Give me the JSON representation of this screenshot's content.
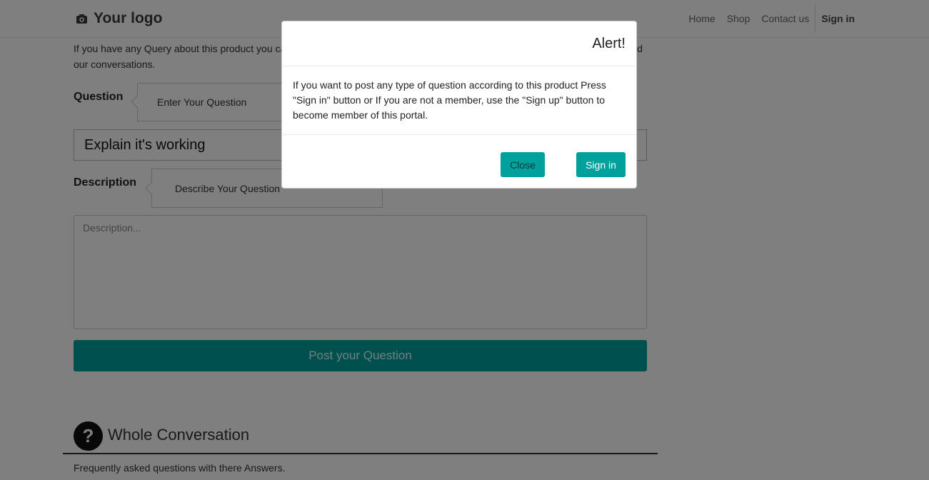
{
  "navbar": {
    "logo_text": "Your logo",
    "links": [
      "Home",
      "Shop",
      "Contact us"
    ],
    "signin_label": "Sign in"
  },
  "intro": {
    "text": "If you have any Query about this product you can ask here by typing it in the box below. Use the Conversation panel for your and our conversations."
  },
  "question": {
    "label": "Question",
    "tooltip": "Enter Your Question",
    "value": "Explain it's working"
  },
  "description": {
    "label": "Description",
    "tooltip": "Describe Your Question",
    "placeholder": "Description..."
  },
  "post_button": "Post your Question",
  "conversation": {
    "icon": "?",
    "title": "Whole Conversation",
    "subtitle": "Frequently asked questions with there Answers."
  },
  "modal": {
    "title": "Alert!",
    "body": "If you want to post any type of question according to this product Press \"Sign in\" button or If you are not a member, use the \"Sign up\" button to become member of this portal.",
    "close_label": "Close",
    "signin_label": "Sign in"
  },
  "colors": {
    "accent": "#00A09D"
  }
}
